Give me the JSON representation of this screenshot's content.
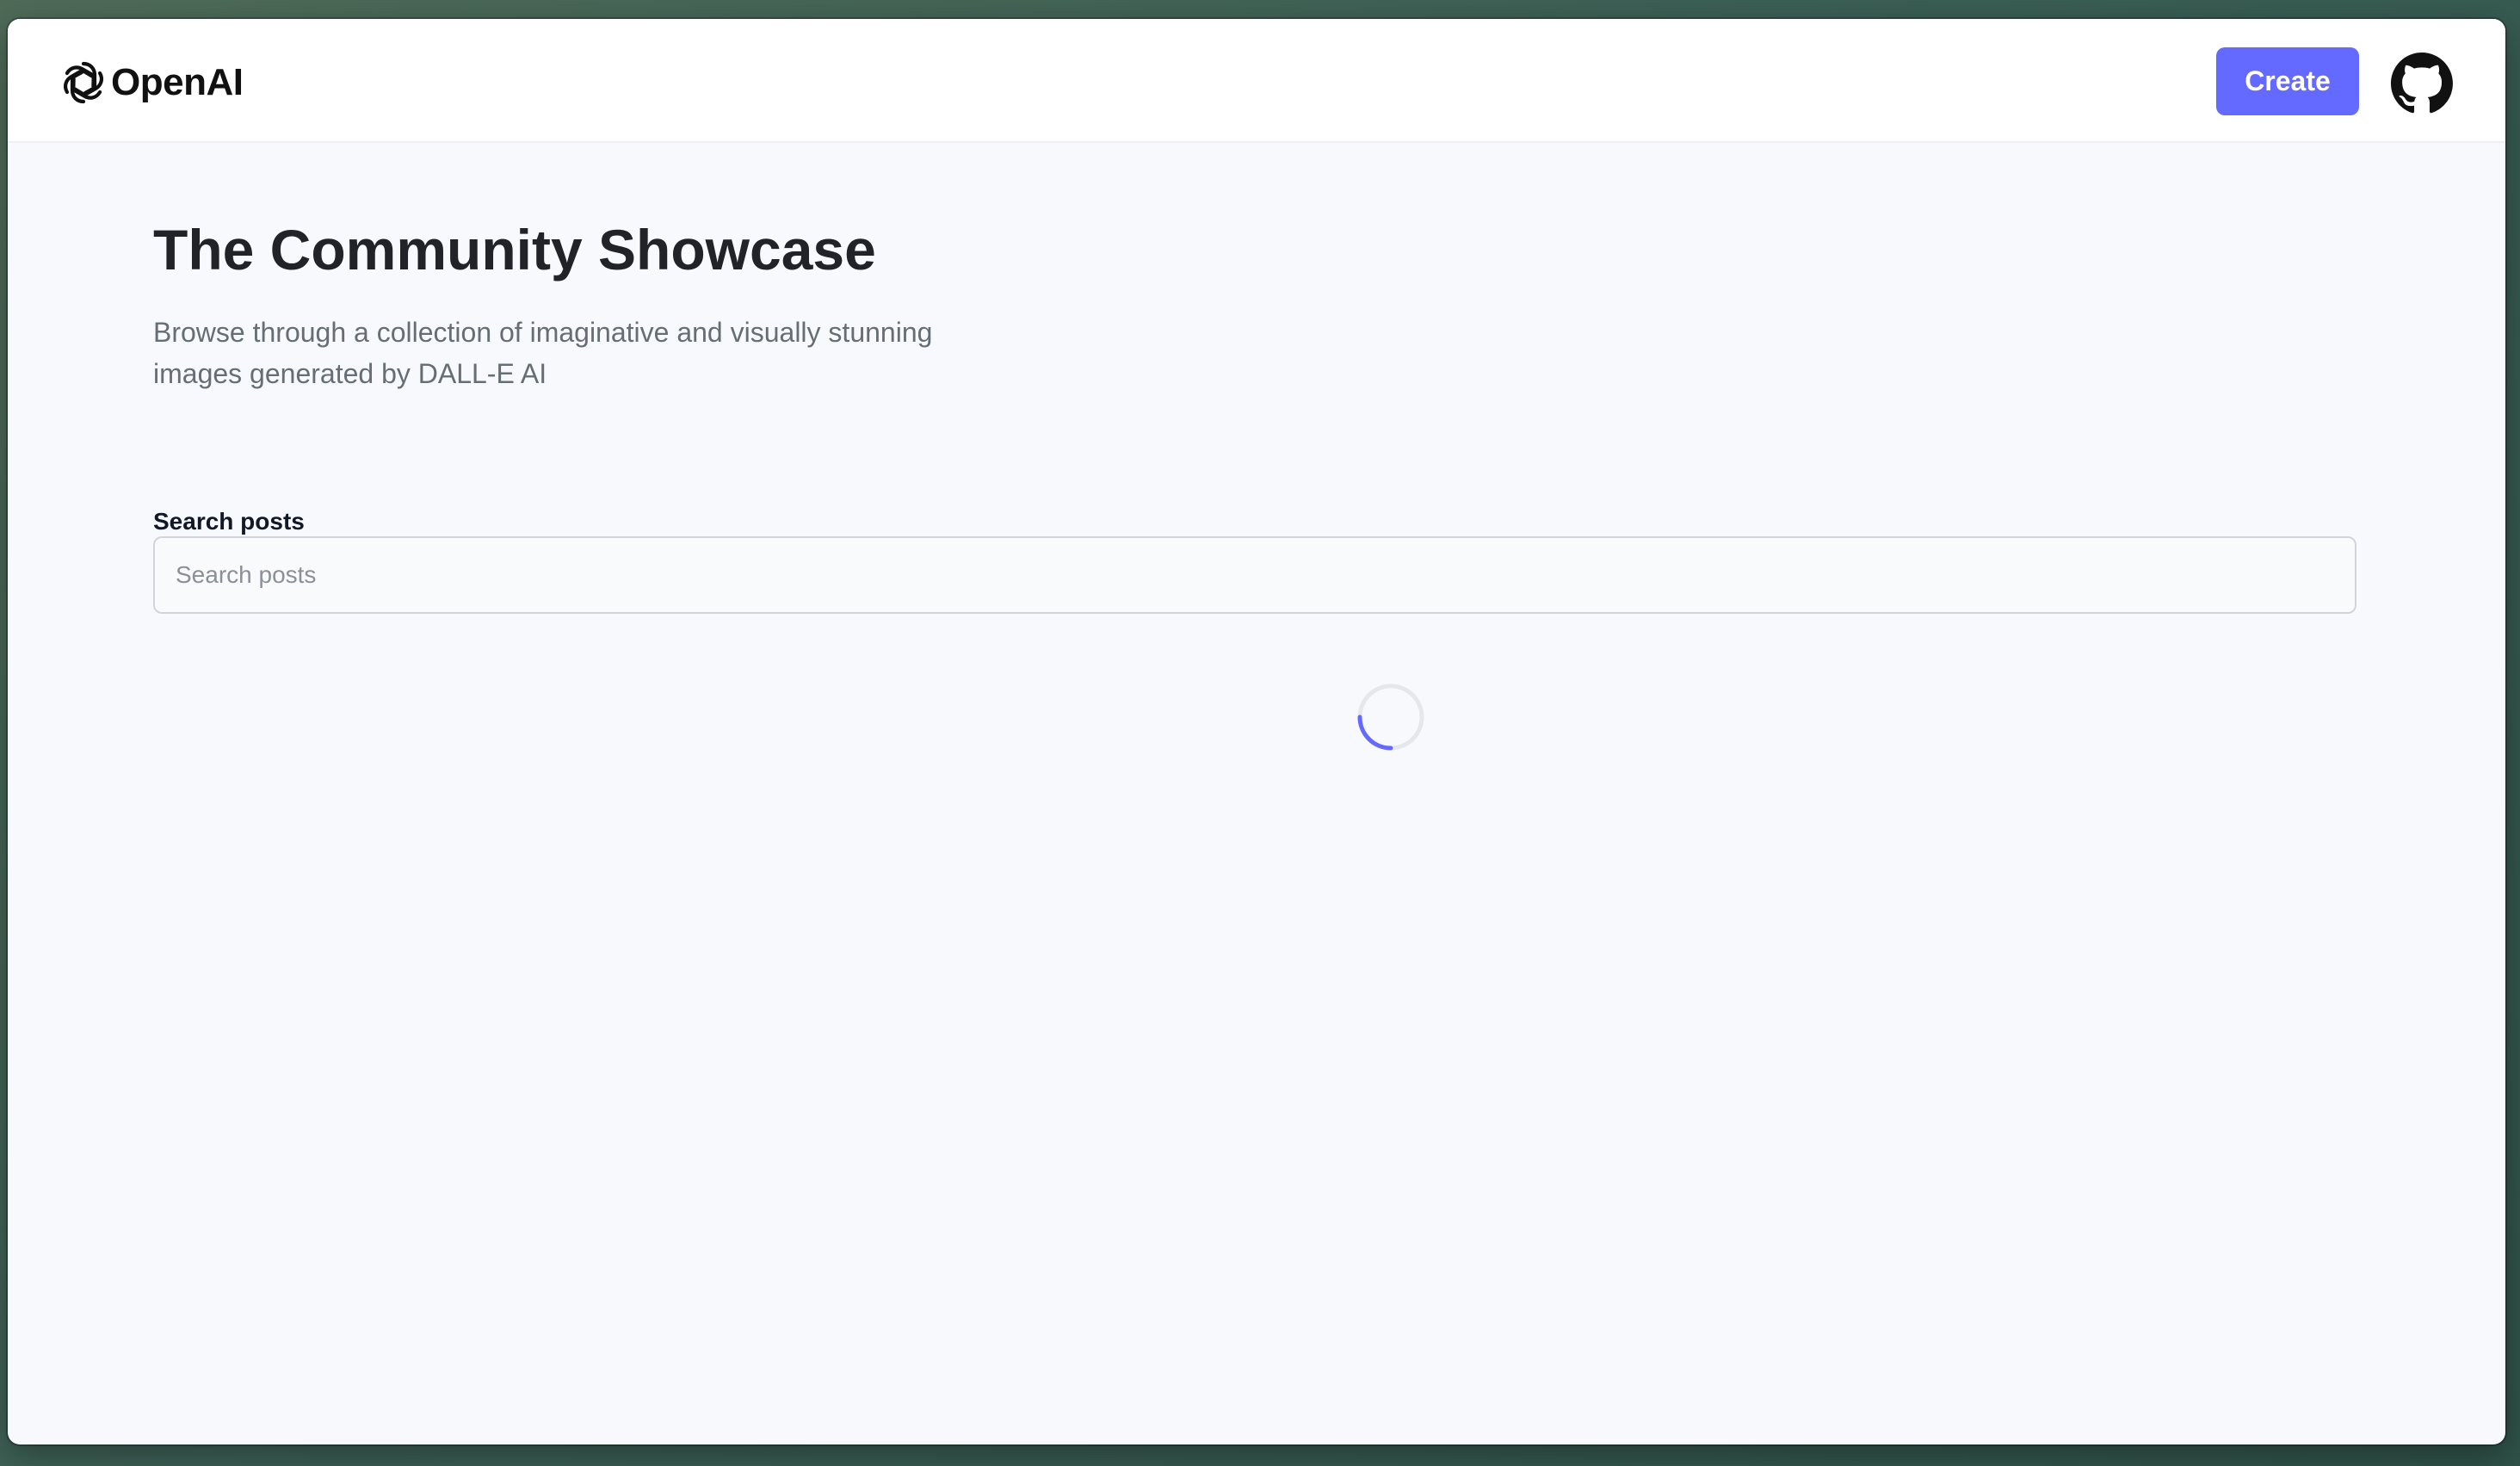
{
  "header": {
    "logo_text": "OpenAI",
    "create_label": "Create",
    "accent_color": "#6469ff"
  },
  "main": {
    "title": "The Community Showcase",
    "subtitle": "Browse through a collection of imaginative and visually stunning images generated by DALL-E AI",
    "search": {
      "label": "Search posts",
      "placeholder": "Search posts",
      "value": ""
    }
  },
  "icons": {
    "logo": "openai-logo-icon",
    "github": "github-icon",
    "loader": "loading-spinner"
  }
}
